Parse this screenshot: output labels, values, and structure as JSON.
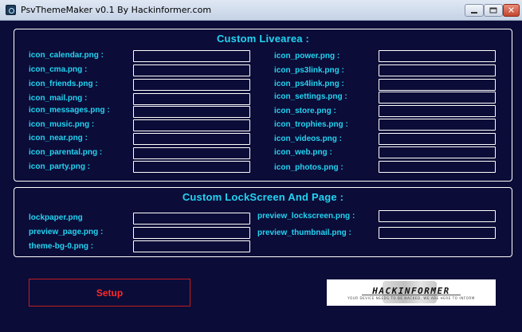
{
  "window": {
    "title": "PsvThemeMaker v0.1 By Hackinformer.com",
    "close_glyph": "✕"
  },
  "livearea": {
    "title": "Custom Livearea :",
    "left_labels": [
      "icon_calendar.png :",
      "icon_cma.png :",
      "icon_friends.png :",
      "icon_mail.png :",
      "icon_messages.png :",
      "icon_music.png :",
      "icon_near.png :",
      "icon_parental.png :",
      "icon_party.png :"
    ],
    "right_labels": [
      "icon_power.png :",
      "icon_ps3link.png :",
      "icon_ps4link.png :",
      "icon_settings.png :",
      "icon_store.png :",
      "icon_trophies.png :",
      "icon_videos.png :",
      "icon_web.png :",
      "icon_photos.png :"
    ]
  },
  "lockscreen": {
    "title": "Custom LockScreen And Page :",
    "left_labels": [
      "lockpaper.png",
      "preview_page.png :",
      "theme-bg-0.png :"
    ],
    "right_labels": [
      "preview_lockscreen.png :",
      "preview_thumbnail.png :"
    ]
  },
  "actions": {
    "setup_label": "Setup"
  },
  "logo": {
    "wordmark": "HACKINFORMER",
    "tagline": "YOUR DEVICE NEEDS TO BE HACKED, WE ARE HERE TO INFORM"
  },
  "colors": {
    "background": "#0c0c38",
    "label": "#22d4f2",
    "setup": "#ff2a2a"
  }
}
